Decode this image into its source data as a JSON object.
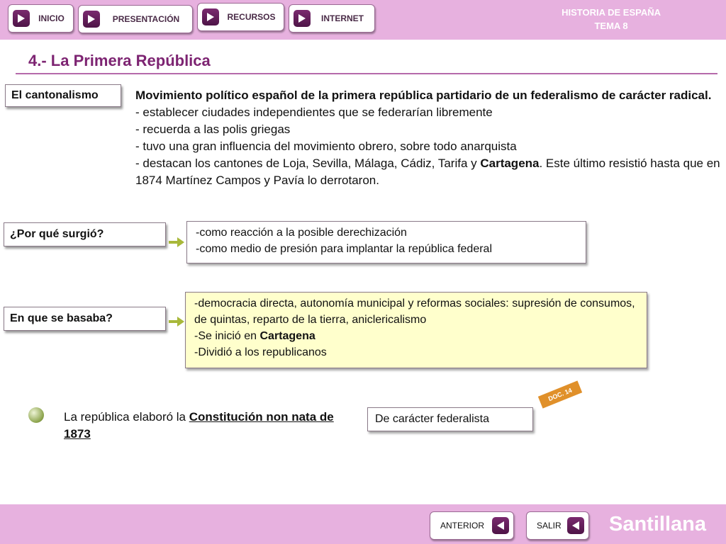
{
  "nav": {
    "items": [
      {
        "label": "INICIO",
        "icon": "play-icon"
      },
      {
        "label": "PRESENTACIÓN",
        "icon": "play-icon"
      },
      {
        "label": "RECURSOS",
        "icon": "play-icon"
      },
      {
        "label": "INTERNET",
        "icon": "play-icon"
      }
    ],
    "brand_line1": "HISTORIA DE ESPAÑA",
    "brand_line2": "TEMA 8"
  },
  "page": {
    "title": "4.- La Primera República"
  },
  "cantonalismo": {
    "label": "El cantonalismo",
    "lead": "Movimiento político español de la primera república partidario de un federalismo de carácter radical.",
    "lines": [
      "- establecer ciudades independientes que se federarían libremente",
      "- recuerda a las polis griegas",
      "- tuvo una gran influencia del movimiento obrero, sobre todo anarquista"
    ],
    "last_line_pre": "- destacan los cantones de Loja, Sevilla, Málaga, Cádiz, Tarifa y ",
    "last_line_bold": "Cartagena",
    "last_line_post": ". Este último resistió hasta que en 1874 Martínez Campos y Pavía lo derrotaron."
  },
  "por_que": {
    "label": "¿Por qué surgió?",
    "lines": [
      "-como reacción a la posible derechización",
      "-como medio de presión para implantar la república federal"
    ]
  },
  "basaba": {
    "label": "En que se basaba?",
    "line1": "-democracia directa, autonomía municipal y reformas sociales: supresión de consumos, de quintas, reparto de la tierra, aniclericalismo",
    "line2_pre": "-Se inició en ",
    "line2_bold": "Cartagena",
    "line3": "-Dividió a los republicanos"
  },
  "constitucion": {
    "pre": "La república elaboró la ",
    "underlined": "Constitución non nata de 1873",
    "box": "De carácter federalista",
    "doc_badge": "DOC. 14"
  },
  "footer": {
    "prev": "ANTERIOR",
    "exit": "SALIR",
    "brand": "Santillana"
  },
  "colors": {
    "bar": "#e7b1df",
    "title": "#7d2472",
    "button_icon": "#5e1a56",
    "yellow_box": "#ffffcc",
    "arrow": "#a8b83a",
    "doc_badge": "#e0902a"
  }
}
